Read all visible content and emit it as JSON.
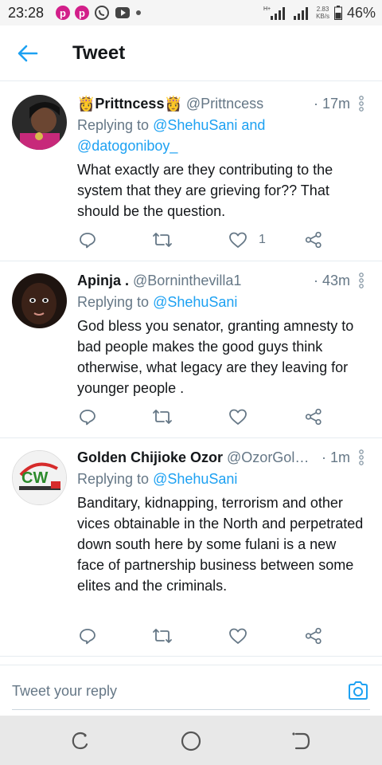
{
  "status_bar": {
    "time": "23:28",
    "speed_value": "2.83",
    "speed_unit": "KB/s",
    "network": "H+",
    "battery": "46%",
    "notification_icons": [
      "pinterest-p-icon",
      "pinterest-p-icon",
      "whatsapp-icon",
      "youtube-icon",
      "dot-icon"
    ]
  },
  "header": {
    "title": "Tweet"
  },
  "tweets": [
    {
      "name": "👸Prittncess👸",
      "handle": "@Prittncess",
      "time": "· 17m",
      "replying_prefix": "Replying to ",
      "replying_mentions": "@ShehuSani and",
      "replying_mentions_2": "@datogoniboy_",
      "text": "What exactly are they contributing to the system that they are grieving for?? That should be the question.",
      "like_count": "1"
    },
    {
      "name": "Apinja .",
      "handle": "@Borninthevilla1",
      "time": "· 43m",
      "replying_prefix": "Replying to ",
      "replying_mentions": "@ShehuSani",
      "text": "God bless you senator, granting amnesty to bad people makes the good guys think otherwise, what legacy are they leaving for younger people  .",
      "like_count": ""
    },
    {
      "name": "Golden Chijioke Ozor",
      "handle": "@OzorGol…",
      "time": "· 1m",
      "replying_prefix": "Replying to ",
      "replying_mentions": "@ShehuSani",
      "text": "Banditary, kidnapping,  terrorism and other vices obtainable in the North and perpetrated  down south here by some fulani is a new face of partnership business between some elites and the criminals.",
      "like_count": ""
    }
  ],
  "reply_bar": {
    "placeholder": "Tweet your reply"
  },
  "colors": {
    "accent": "#1da1f2",
    "text_secondary": "#657786",
    "divider": "#e6ecf0"
  }
}
